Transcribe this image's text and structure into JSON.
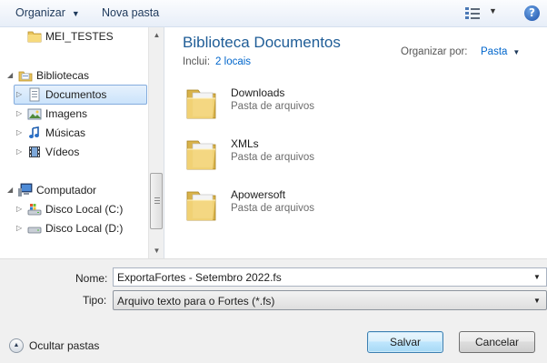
{
  "toolbar": {
    "organize_label": "Organizar",
    "new_folder_label": "Nova pasta"
  },
  "nav": {
    "items": [
      {
        "label": "MEI_TESTES"
      },
      {
        "label": "Bibliotecas"
      },
      {
        "label": "Documentos"
      },
      {
        "label": "Imagens"
      },
      {
        "label": "Músicas"
      },
      {
        "label": "Vídeos"
      },
      {
        "label": "Computador"
      },
      {
        "label": "Disco Local (C:)"
      },
      {
        "label": "Disco Local (D:)"
      }
    ]
  },
  "library": {
    "title": "Biblioteca Documentos",
    "include_label": "Inclui:",
    "include_link": "2 locais",
    "arrange_label": "Organizar por:",
    "arrange_value": "Pasta"
  },
  "files": [
    {
      "name": "Downloads",
      "type": "Pasta de arquivos"
    },
    {
      "name": "XMLs",
      "type": "Pasta de arquivos"
    },
    {
      "name": "Apowersoft",
      "type": "Pasta de arquivos"
    }
  ],
  "form": {
    "name_label": "Nome:",
    "name_value": "ExportaFortes - Setembro 2022.fs",
    "type_label": "Tipo:",
    "type_value": "Arquivo texto para o Fortes (*.fs)"
  },
  "footer": {
    "hide_folders_label": "Ocultar pastas",
    "save_label": "Salvar",
    "cancel_label": "Cancelar"
  },
  "colors": {
    "accent": "#1f5d97",
    "link": "#0066cc",
    "selection": "#cbe3fb"
  }
}
